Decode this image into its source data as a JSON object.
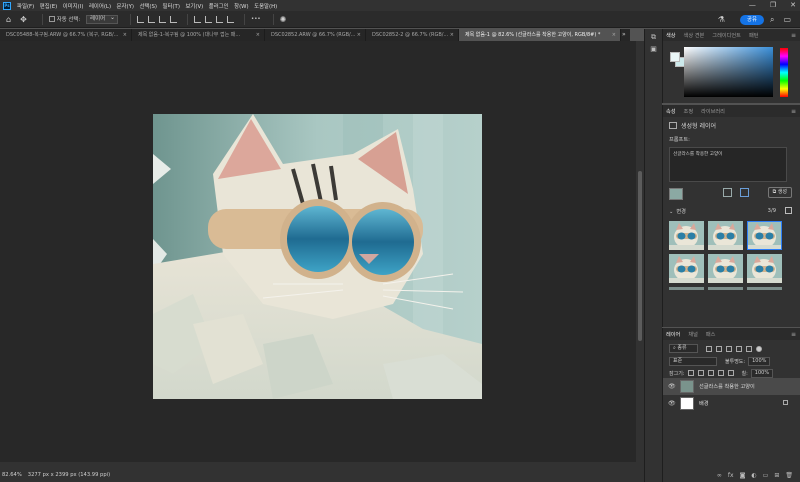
{
  "app": {
    "logo": "Ps"
  },
  "menu": [
    "파일(F)",
    "편집(E)",
    "이미지(I)",
    "레이어(L)",
    "문자(Y)",
    "선택(S)",
    "필터(T)",
    "보기(V)",
    "플러그인",
    "창(W)",
    "도움말(H)"
  ],
  "window_controls": [
    "—",
    "❐",
    "✕"
  ],
  "options": {
    "auto_select_label": "자동 선택:",
    "layer_select": "레이어",
    "more": "•••",
    "share": "공유"
  },
  "tabs": [
    {
      "label": "DSC05488-복구됨.ARW @ 66.7% (복구, RGB/...",
      "active": false
    },
    {
      "label": "제목 없음-1-복구됨 @ 100% (대나무 껍는 패...",
      "active": false
    },
    {
      "label": "DSC02852.ARW @ 66.7% (RGB/...",
      "active": false
    },
    {
      "label": "DSC02852-2 @ 66.7% (RGB/...",
      "active": false
    },
    {
      "label": "제목 없음-1 @ 82.6% (선글라스를 착용한 고양이, RGB/8#) *",
      "active": true
    }
  ],
  "tabs_overflow": "»",
  "status": {
    "zoom": "82.64%",
    "doc_info": "3277 px x 2399 px (143.99 ppi)"
  },
  "color_panel": {
    "tabs": [
      "색상",
      "색상 견본",
      "그레이디언트",
      "패턴"
    ],
    "colors": {
      "foreground": "#eaf6f7",
      "background": "#cce9eb",
      "field_hue": "#3a8fd9"
    }
  },
  "properties": {
    "tabs": [
      "속성",
      "조정",
      "라이브러리"
    ],
    "generated_layer_label": "생성형 레이어",
    "prompt_label": "프롬프트:",
    "prompt_text": "선글라스를 착용한 고양이",
    "generate_label": "생성",
    "variations_label": "변경",
    "variations_count": "3/9",
    "variation_count": 6,
    "selected_variation": 3
  },
  "layers": {
    "tabs": [
      "레이어",
      "채널",
      "패스"
    ],
    "filter_label": "종류",
    "blend_mode": "표준",
    "opacity_label": "불투명도:",
    "opacity": "100%",
    "lock_label": "잠그기:",
    "fill_label": "칠:",
    "fill": "100%",
    "items": [
      {
        "name": "선글라스를 착용한 고양이",
        "selected": true,
        "thumb_color": "#7a938c"
      },
      {
        "name": "배경",
        "selected": false,
        "thumb_color": "#ffffff"
      }
    ]
  }
}
